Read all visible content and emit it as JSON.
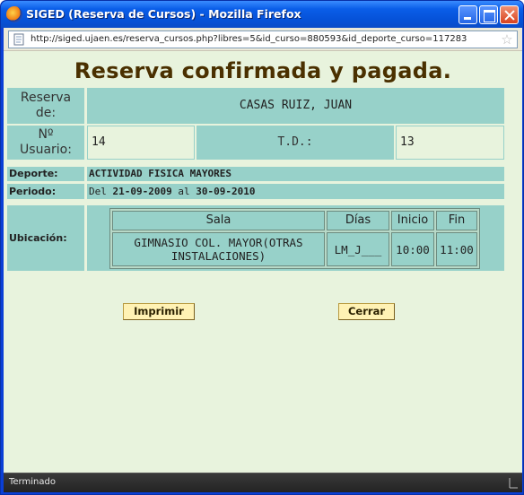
{
  "window": {
    "title": "SIGED (Reserva de Cursos) - Mozilla Firefox",
    "minimize_glyph": "",
    "maximize_glyph": "",
    "close_glyph": ""
  },
  "urlbar": {
    "url": "http://siged.ujaen.es/reserva_cursos.php?libres=5&id_curso=880593&id_deporte_curso=117283"
  },
  "page": {
    "title": "Reserva confirmada y pagada.",
    "reserva_label_1": "Reserva",
    "reserva_label_2": "de:",
    "reserva_value": "CASAS RUIZ, JUAN",
    "usuario_label_1": "Nº",
    "usuario_label_2": "Usuario:",
    "usuario_value": "14",
    "td_label": "T.D.:",
    "td_value": "13",
    "deporte_label": "Deporte:",
    "deporte_value": "ACTIVIDAD FISICA MAYORES",
    "periodo_label": "Periodo:",
    "periodo_del": "Del",
    "periodo_start": "21-09-2009",
    "periodo_al": "al",
    "periodo_end": "30-09-2010",
    "ubicacion_label": "Ubicación:",
    "table": {
      "headers": [
        "Sala",
        "Días",
        "Inicio",
        "Fin"
      ],
      "row": {
        "sala_1": "GIMNASIO COL. MAYOR(OTRAS",
        "sala_2": "INSTALACIONES)",
        "dias": "LM_J___",
        "inicio": "10:00",
        "fin": "11:00"
      }
    },
    "buttons": {
      "print": "Imprimir",
      "close": "Cerrar"
    }
  },
  "status": {
    "text": "Terminado"
  },
  "colors": {
    "cell_bg": "#97d1c9",
    "page_bg": "#e8f3dd",
    "title_color": "#4a3000",
    "button_bg": "#fff2b4"
  }
}
